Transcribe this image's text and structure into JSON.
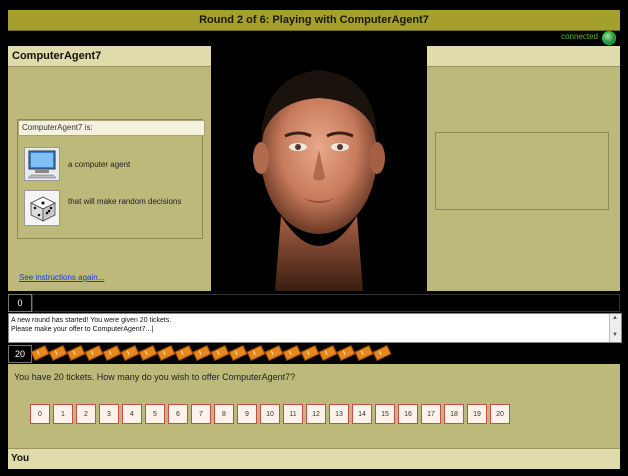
{
  "header": {
    "title": "Round 2 of 6: Playing with ComputerAgent7"
  },
  "status": {
    "connection_text": "connected",
    "connection_icon": "connected-globe-icon"
  },
  "left_panel": {
    "agent_name": "ComputerAgent7",
    "info_heading": "ComputerAgent7 is:",
    "info_items": [
      {
        "icon": "computer-icon",
        "text": "a computer agent"
      },
      {
        "icon": "dice-icon",
        "text": "that will make random decisions"
      }
    ],
    "instructions_link": "See instructions again..."
  },
  "counter": {
    "value": "0"
  },
  "log": {
    "line1": "A new round has started! You were given 20 tickets.",
    "line2": "Please make your offer to ComputerAgent7...|"
  },
  "tickets": {
    "count": "20",
    "num_tickets": 20
  },
  "offer": {
    "prompt": "You have 20 tickets.  How many do you wish to offer ComputerAgent7?",
    "options": [
      "0",
      "1",
      "2",
      "3",
      "4",
      "5",
      "6",
      "7",
      "8",
      "9",
      "10",
      "11",
      "12",
      "13",
      "14",
      "15",
      "16",
      "17",
      "18",
      "19",
      "20"
    ]
  },
  "footer": {
    "you_label": "You"
  },
  "colors": {
    "title_bar": "#a5a02e",
    "panel": "#bdb97a",
    "panel_header": "#dfdbaa",
    "ticket": "#e8881c",
    "button_border": "#c84c4c"
  }
}
